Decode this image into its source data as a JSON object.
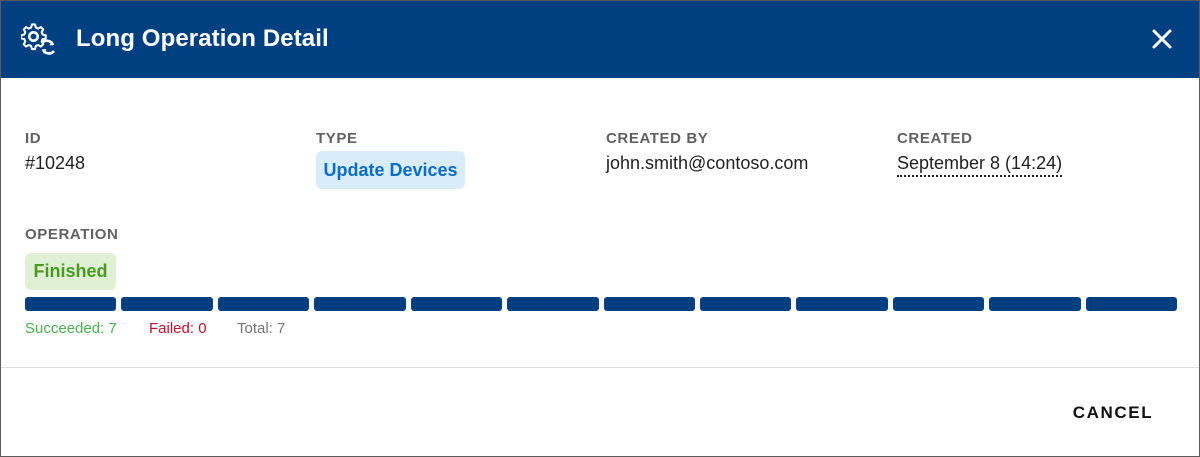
{
  "dialog": {
    "title": "Long Operation Detail",
    "header_icon": "gear-sync-icon",
    "close_icon": "close-icon",
    "colors": {
      "header": "#004080",
      "progress": "#004080"
    }
  },
  "details": {
    "id": {
      "label": "ID",
      "value": "#10248"
    },
    "type": {
      "label": "TYPE",
      "value": "Update Devices"
    },
    "created_by": {
      "label": "CREATED BY",
      "value": "john.smith@contoso.com"
    },
    "created": {
      "label": "CREATED",
      "value": "September 8 (14:24)"
    }
  },
  "operation": {
    "label": "OPERATION",
    "status": "Finished",
    "progress_fraction": 1.0,
    "segments": 12,
    "stats": {
      "succeeded": "Succeeded: 7",
      "failed": "Failed: 0",
      "total": "Total: 7"
    }
  },
  "footer": {
    "cancel_label": "CANCEL"
  }
}
